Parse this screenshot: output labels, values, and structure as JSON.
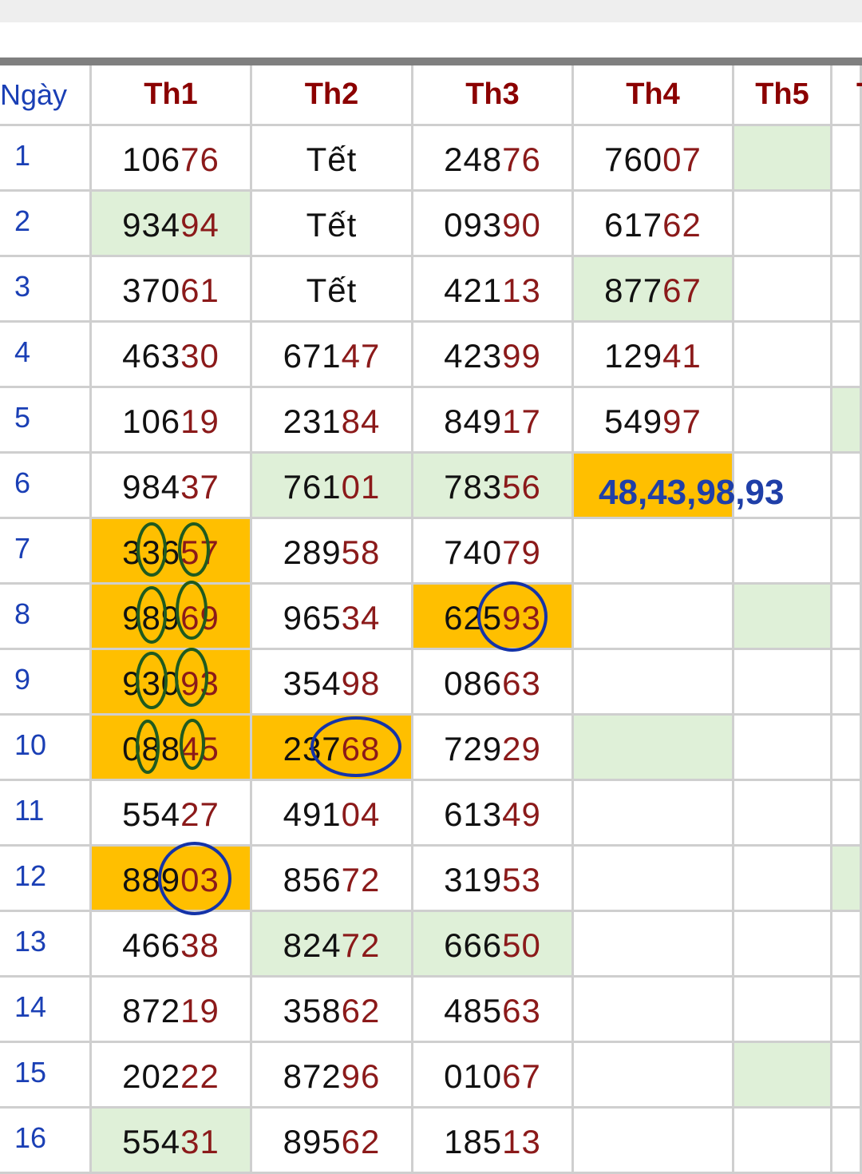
{
  "header": {
    "day_label": "Ngày",
    "columns": [
      "Th1",
      "Th2",
      "Th3",
      "Th4",
      "Th5",
      "T"
    ]
  },
  "rows": [
    {
      "day": "1",
      "cells": [
        "10676",
        "Tết",
        "24876",
        "76007",
        "",
        ""
      ]
    },
    {
      "day": "2",
      "cells": [
        "93494",
        "Tết",
        "09390",
        "61762",
        "",
        ""
      ]
    },
    {
      "day": "3",
      "cells": [
        "37061",
        "Tết",
        "42113",
        "87767",
        "",
        ""
      ]
    },
    {
      "day": "4",
      "cells": [
        "46330",
        "67147",
        "42399",
        "12941",
        "",
        ""
      ]
    },
    {
      "day": "5",
      "cells": [
        "10619",
        "23184",
        "84917",
        "54997",
        "",
        ""
      ]
    },
    {
      "day": "6",
      "cells": [
        "98437",
        "76101",
        "78356",
        "",
        "",
        ""
      ]
    },
    {
      "day": "7",
      "cells": [
        "33657",
        "28958",
        "74079",
        "",
        "",
        ""
      ]
    },
    {
      "day": "8",
      "cells": [
        "98969",
        "96534",
        "62593",
        "",
        "",
        ""
      ]
    },
    {
      "day": "9",
      "cells": [
        "93093",
        "35498",
        "08663",
        "",
        "",
        ""
      ]
    },
    {
      "day": "10",
      "cells": [
        "08845",
        "23768",
        "72929",
        "",
        "",
        ""
      ]
    },
    {
      "day": "11",
      "cells": [
        "55427",
        "49104",
        "61349",
        "",
        "",
        ""
      ]
    },
    {
      "day": "12",
      "cells": [
        "88903",
        "85672",
        "31953",
        "",
        "",
        ""
      ]
    },
    {
      "day": "13",
      "cells": [
        "46638",
        "82472",
        "66650",
        "",
        "",
        ""
      ]
    },
    {
      "day": "14",
      "cells": [
        "87219",
        "35862",
        "48563",
        "",
        "",
        ""
      ]
    },
    {
      "day": "15",
      "cells": [
        "20222",
        "87296",
        "01067",
        "",
        "",
        ""
      ]
    },
    {
      "day": "16",
      "cells": [
        "55431",
        "89562",
        "18513",
        "",
        "",
        ""
      ]
    }
  ],
  "highlights": {
    "green": [
      [
        0,
        4
      ],
      [
        1,
        0
      ],
      [
        2,
        3
      ],
      [
        4,
        5
      ],
      [
        5,
        1
      ],
      [
        5,
        2
      ],
      [
        7,
        4
      ],
      [
        9,
        3
      ],
      [
        11,
        5
      ],
      [
        12,
        1
      ],
      [
        12,
        2
      ],
      [
        14,
        4
      ],
      [
        15,
        0
      ]
    ],
    "orange": [
      [
        5,
        3
      ],
      [
        6,
        0
      ],
      [
        7,
        0
      ],
      [
        7,
        2
      ],
      [
        8,
        0
      ],
      [
        9,
        0
      ],
      [
        9,
        1
      ],
      [
        11,
        0
      ]
    ]
  },
  "annotation_text": "48,43,98,93",
  "colors": {
    "header_text": "#8b0000",
    "day_text": "#1a3fb5",
    "highlight_digits": "#8b1a1a",
    "green_fill": "#dff0d8",
    "orange_fill": "#ffbf00",
    "annotation": "#1f3fa8",
    "green_ovals": "#1f5a1f",
    "blue_circles": "#1433a8"
  }
}
